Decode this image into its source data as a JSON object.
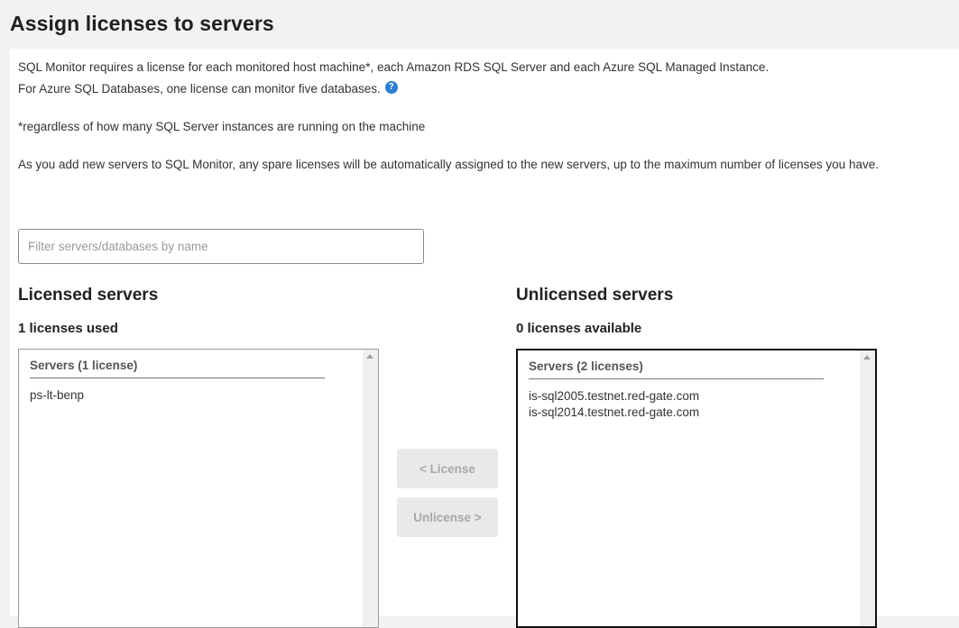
{
  "page": {
    "title": "Assign licenses to servers"
  },
  "intro": {
    "line1": "SQL Monitor requires a license for each monitored host machine*, each Amazon RDS SQL Server and each Azure SQL Managed Instance.",
    "line2": "For Azure SQL Databases, one license can monitor five databases.",
    "help_icon_glyph": "?",
    "footnote": "*regardless of how many SQL Server instances are running on the machine",
    "auto_assign": "As you add new servers to SQL Monitor, any spare licenses will be automatically assigned to the new servers, up to the maximum number of licenses you have."
  },
  "filter": {
    "placeholder": "Filter servers/databases by name",
    "value": ""
  },
  "licensed": {
    "heading": "Licensed servers",
    "count_label": "1 licenses used",
    "list_header": "Servers (1 license)",
    "items": [
      "ps-lt-benp"
    ]
  },
  "unlicensed": {
    "heading": "Unlicensed servers",
    "count_label": "0 licenses available",
    "list_header": "Servers (2 licenses)",
    "items": [
      "is-sql2005.testnet.red-gate.com",
      "is-sql2014.testnet.red-gate.com"
    ]
  },
  "actions": {
    "license_label": "< License",
    "unlicense_label": "Unlicense >"
  },
  "colors": {
    "accent": "#2d7dd2",
    "disabled_button_bg": "#e9e9e9",
    "disabled_button_text": "#a9a9a9"
  }
}
